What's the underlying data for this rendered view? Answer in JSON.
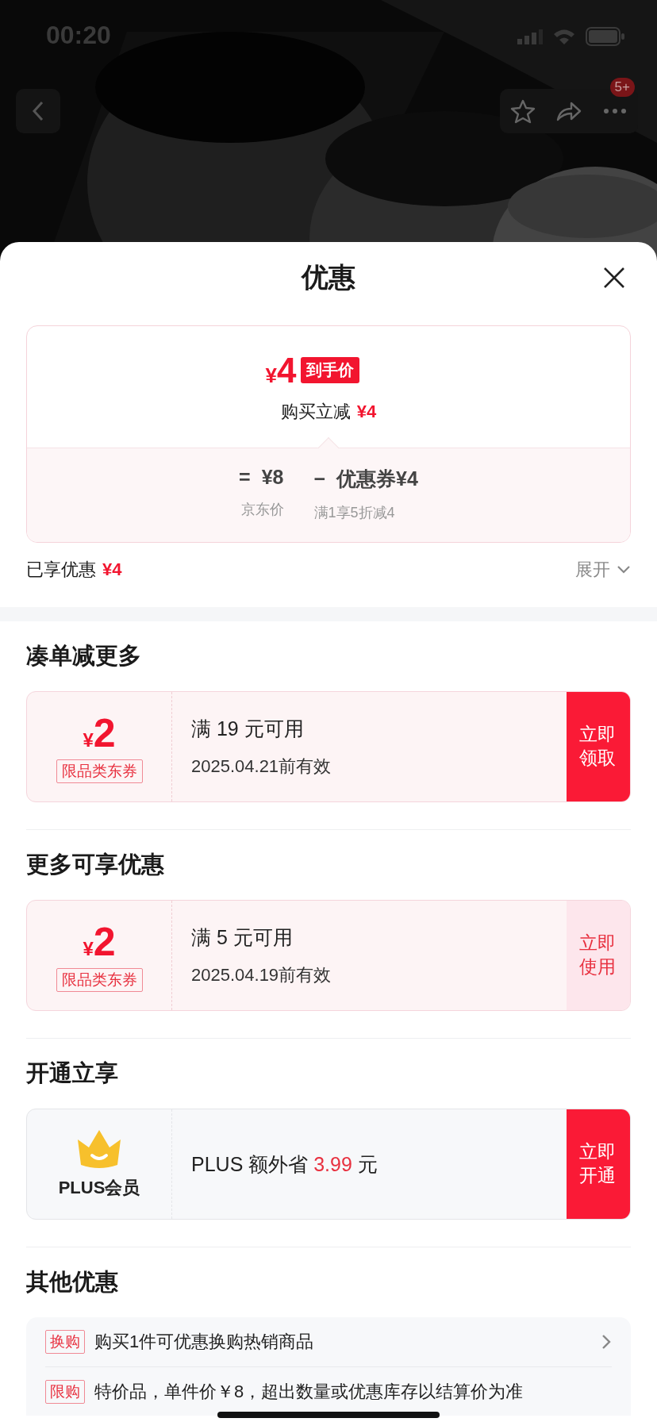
{
  "status_bar": {
    "time": "00:20"
  },
  "nav": {
    "badge": "5+"
  },
  "sheet": {
    "title": "优惠"
  },
  "price_card": {
    "currency": "¥",
    "final_price": "4",
    "final_label": "到手价",
    "instant_label": "购买立减",
    "instant_amount": "¥4",
    "equals": "=",
    "jd_price": "¥8",
    "minus": "−",
    "coupon_label": "优惠券¥4",
    "jd_price_label": "京东价",
    "coupon_note": "满1享5折减4"
  },
  "summary": {
    "label": "已享优惠",
    "amount": "¥4",
    "expand": "展开"
  },
  "sections": [
    {
      "title": "凑单减更多",
      "kind": "coupon",
      "coupon": {
        "kind": "claim",
        "currency": "¥",
        "amount": "2",
        "tag": "限品类东券",
        "condition": "满 19 元可用",
        "validity": "2025.04.21前有效",
        "action": "立即领取"
      }
    },
    {
      "title": "更多可享优惠",
      "kind": "coupon",
      "coupon": {
        "kind": "use",
        "currency": "¥",
        "amount": "2",
        "tag": "限品类东券",
        "condition": "满 5 元可用",
        "validity": "2025.04.19前有效",
        "action": "立即使用"
      }
    },
    {
      "title": "开通立享",
      "kind": "plus",
      "plus": {
        "label": "PLUS会员",
        "text": "PLUS 额外省 ",
        "highlight": "3.99",
        "suffix": " 元",
        "action": "立即开通"
      }
    },
    {
      "title": "其他优惠",
      "kind": "list",
      "items": [
        {
          "tag": "换购",
          "text": "购买1件可优惠换购热销商品",
          "arrow": true
        },
        {
          "tag": "限购",
          "text": "特价品，单件价￥8，超出数量或优惠库存以结算价为准",
          "arrow": false
        }
      ]
    }
  ]
}
